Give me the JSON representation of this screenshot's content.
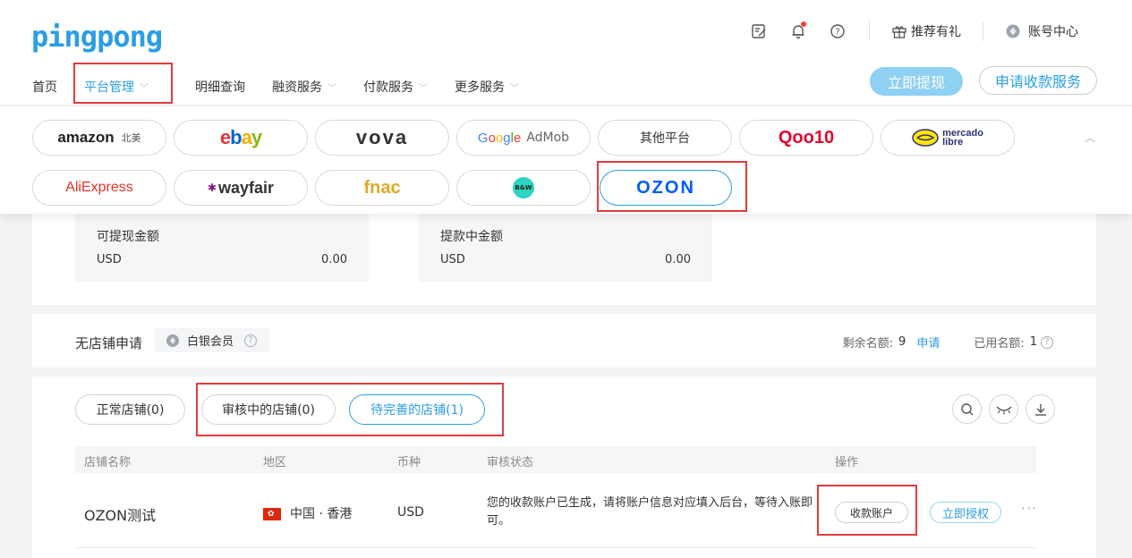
{
  "brand": {
    "logo_text": "pingpong",
    "color": "#2a9ee6"
  },
  "topbar": {
    "icons": [
      "edit-note-icon",
      "bell-icon",
      "help-circle-icon"
    ],
    "referral_label": "推荐有礼",
    "account_label": "账号中心"
  },
  "nav": {
    "items": [
      {
        "label": "首页",
        "has_dropdown": false
      },
      {
        "label": "平台管理",
        "has_dropdown": true,
        "active": true
      },
      {
        "label": "明细查询",
        "has_dropdown": false
      },
      {
        "label": "融资服务",
        "has_dropdown": true
      },
      {
        "label": "付款服务",
        "has_dropdown": true
      },
      {
        "label": "更多服务",
        "has_dropdown": true
      }
    ],
    "withdraw_button": "立即提现",
    "apply_service_button": "申请收款服务"
  },
  "platforms": {
    "row1": [
      {
        "name": "amazon",
        "sub": "北美"
      },
      {
        "name": "ebay"
      },
      {
        "name": "vova"
      },
      {
        "name": "Google",
        "sub": "AdMob"
      },
      {
        "name": "其他平台"
      },
      {
        "name": "Qoo10"
      },
      {
        "name": "mercado",
        "sub": "libre"
      }
    ],
    "row2": [
      {
        "name": "AliExpress"
      },
      {
        "name": "wayfair"
      },
      {
        "name": "fnac"
      },
      {
        "name": "B&W"
      },
      {
        "name": "OZON",
        "selected": true
      }
    ]
  },
  "balance": {
    "available": {
      "title": "可提现金额",
      "currency": "USD",
      "value": "0.00"
    },
    "withdrawing": {
      "title": "提款中金额",
      "currency": "USD",
      "value": "0.00"
    }
  },
  "no_store": {
    "title": "无店铺申请",
    "member_badge": "白银会员",
    "remaining_label": "剩余名额:",
    "remaining_value": "9",
    "apply_link": "申请",
    "used_label": "已用名额:",
    "used_value": "1"
  },
  "stores": {
    "tabs": [
      {
        "label": "正常店铺(0)",
        "active": false
      },
      {
        "label": "审核中的店铺(0)",
        "active": false
      },
      {
        "label": "待完善的店铺(1)",
        "active": true
      }
    ],
    "columns": [
      "店铺名称",
      "地区",
      "币种",
      "审核状态",
      "操作"
    ],
    "rows": [
      {
        "name": "OZON测试",
        "region": "中国 · 香港",
        "currency": "USD",
        "status": "您的收款账户已生成，请将账户信息对应填入后台，等待入账即可。",
        "action_account": "收款账户",
        "action_authorize": "立即授权"
      }
    ]
  },
  "colors": {
    "accent": "#2a9ee6",
    "highlight_red": "#e33b3b",
    "light_blue_button": "#8fd0f3"
  }
}
